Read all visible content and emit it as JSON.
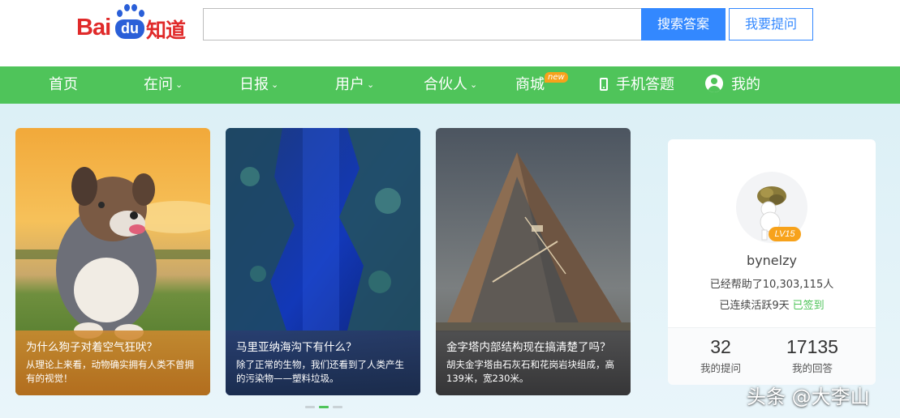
{
  "logo": {
    "text_bai": "Bai",
    "text_du": "du",
    "text_product": "知道"
  },
  "search": {
    "value": "",
    "button_label": "搜索答案",
    "ask_label": "我要提问"
  },
  "nav": {
    "items": [
      {
        "label": "首页"
      },
      {
        "label": "在问",
        "dropdown": true
      },
      {
        "label": "日报",
        "dropdown": true
      },
      {
        "label": "用户",
        "dropdown": true
      },
      {
        "label": "合伙人",
        "dropdown": true
      },
      {
        "label": "商城",
        "badge": "new"
      },
      {
        "label": "手机答题",
        "icon": "phone-icon"
      },
      {
        "label": "我的",
        "icon": "user-icon"
      }
    ]
  },
  "cards": [
    {
      "title": "为什么狗子对着空气狂吠？",
      "desc": "从理论上来看，动物确实拥有人类不曾拥有的视觉！",
      "image": "dog-photo"
    },
    {
      "title": "马里亚纳海沟下有什么？",
      "desc": "除了正常的生物，我们还看到了人类产生的污染物——塑料垃圾。",
      "image": "ocean-trench-photo"
    },
    {
      "title": "金字塔内部结构现在搞清楚了吗？",
      "desc": "胡夫金字塔由石灰石和花岗岩块组成，高139米，宽230米。",
      "image": "pyramid-photo"
    }
  ],
  "carousel": {
    "active_index": 1,
    "count": 3
  },
  "profile": {
    "level": "LV15",
    "username": "bynelzy",
    "helped_text": "已经帮助了10,303,115人",
    "streak_text": "已连续活跃9天",
    "signed_text": "已签到",
    "questions_count": "32",
    "questions_label": "我的提问",
    "answers_count": "17135",
    "answers_label": "我的回答"
  },
  "watermark": "头条 @大李山",
  "colors": {
    "nav_green": "#4fc45a",
    "search_blue": "#3388ff",
    "logo_red": "#e02a2a",
    "logo_blue": "#2a5fd8",
    "badge_orange": "#f7a21b"
  }
}
